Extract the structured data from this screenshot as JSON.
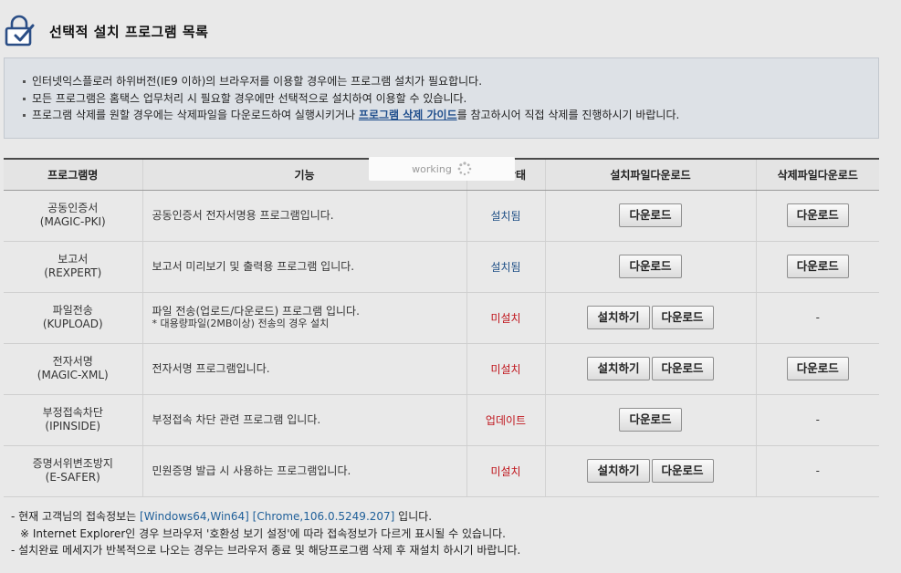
{
  "header": {
    "title": "선택적 설치 프로그램 목록",
    "icon": "lock-check-icon"
  },
  "notice": {
    "items": [
      "인터넷익스플로러 하위버전(IE9 이하)의 브라우저를 이용할 경우에는 프로그램 설치가 필요합니다.",
      "모든 프로그램은 홈택스 업무처리 시 필요할 경우에만 선택적으로 설치하여 이용할 수 있습니다."
    ],
    "item3_before": "프로그램 삭제를 원할 경우에는 삭제파일을 다운로드하여 실행시키거나 ",
    "item3_link": "프로그램 삭제 가이드",
    "item3_after": "를 참고하시어 직접 삭제를 진행하시기 바랍니다."
  },
  "table": {
    "headers": [
      "프로그램명",
      "기능",
      "설치상태",
      "설치파일다운로드",
      "삭제파일다운로드"
    ],
    "rows": [
      {
        "name": "공동인증서",
        "code": "(MAGIC-PKI)",
        "func": "공동인증서 전자서명용 프로그램입니다.",
        "note": "",
        "status": "설치됨",
        "status_type": "ok",
        "install_btn": "",
        "download_btn": "다운로드",
        "delete_btn": "다운로드",
        "delete_text": ""
      },
      {
        "name": "보고서",
        "code": "(REXPERT)",
        "func": "보고서 미리보기 및 출력용 프로그램 입니다.",
        "note": "",
        "status": "설치됨",
        "status_type": "ok",
        "install_btn": "",
        "download_btn": "다운로드",
        "delete_btn": "다운로드",
        "delete_text": ""
      },
      {
        "name": "파일전송",
        "code": "(KUPLOAD)",
        "func": "파일 전송(업로드/다운로드) 프로그램 입니다.",
        "note": "* 대용량파일(2MB이상) 전송의 경우 설치",
        "status": "미설치",
        "status_type": "no",
        "install_btn": "설치하기",
        "download_btn": "다운로드",
        "delete_btn": "",
        "delete_text": "-"
      },
      {
        "name": "전자서명",
        "code": "(MAGIC-XML)",
        "func": "전자서명 프로그램입니다.",
        "note": "",
        "status": "미설치",
        "status_type": "no",
        "install_btn": "설치하기",
        "download_btn": "다운로드",
        "delete_btn": "다운로드",
        "delete_text": ""
      },
      {
        "name": "부정접속차단",
        "code": "(IPINSIDE)",
        "func": "부정접속 차단 관련 프로그램 입니다.",
        "note": "",
        "status": "업데이트",
        "status_type": "no",
        "install_btn": "",
        "download_btn": "다운로드",
        "delete_btn": "",
        "delete_text": "-"
      },
      {
        "name": "증명서위변조방지",
        "code": "(E-SAFER)",
        "func": "민원증명 발급 시 사용하는 프로그램입니다.",
        "note": "",
        "status": "미설치",
        "status_type": "no",
        "install_btn": "설치하기",
        "download_btn": "다운로드",
        "delete_btn": "",
        "delete_text": "-"
      }
    ]
  },
  "overlay": {
    "working_label": "working"
  },
  "footer": {
    "line1_before": "- 현재 고객님의 접속정보는 ",
    "line1_info": "[Windows64,Win64] [Chrome,106.0.5249.207]",
    "line1_after": " 입니다.",
    "line2": "※ Internet Explorer인 경우 브라우저 '호환성 보기 설정'에 따라 접속정보가 다르게 표시될 수 있습니다.",
    "line3": "- 설치완료 메세지가 반복적으로 나오는 경우는 브라우저 종료 및 해당프로그램 삭제 후 재설치 하시기 바랍니다."
  },
  "colors": {
    "installed": "#1f4f86",
    "not_installed": "#c0161d",
    "link": "#1f4e8c"
  }
}
